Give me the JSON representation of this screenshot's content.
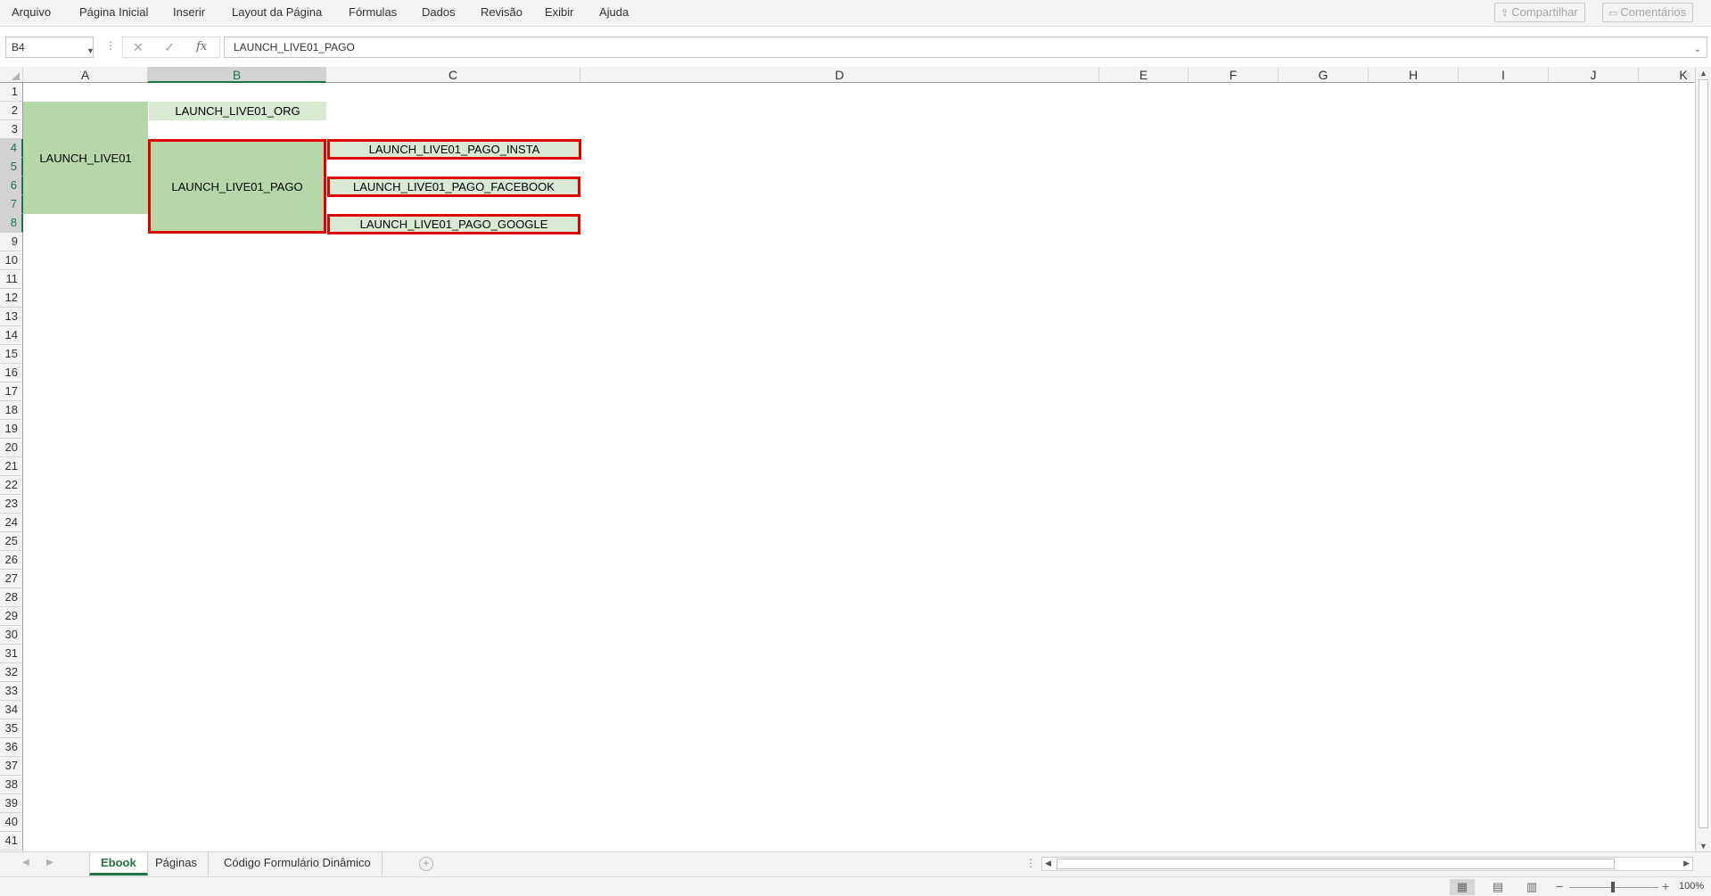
{
  "menu": {
    "items": [
      "Arquivo",
      "Página Inicial",
      "Inserir",
      "Layout da Página",
      "Fórmulas",
      "Dados",
      "Revisão",
      "Exibir",
      "Ajuda"
    ],
    "share_label": "Compartilhar",
    "comments_label": "Comentários"
  },
  "formula_bar": {
    "name_box": "B4",
    "formula": "LAUNCH_LIVE01_PAGO",
    "fx_label": "fx"
  },
  "columns": [
    "A",
    "B",
    "C",
    "D",
    "E",
    "F",
    "G",
    "H",
    "I",
    "J",
    "K"
  ],
  "selected_column": "B",
  "rows": [
    "1",
    "2",
    "3",
    "4",
    "5",
    "6",
    "7",
    "8",
    "9",
    "10",
    "11",
    "12",
    "13",
    "14",
    "15",
    "16",
    "17",
    "18",
    "19",
    "20",
    "21",
    "22",
    "23",
    "24",
    "25",
    "26",
    "27",
    "28",
    "29",
    "30",
    "31",
    "32",
    "33",
    "34",
    "35",
    "36",
    "37",
    "38",
    "39",
    "40",
    "41"
  ],
  "selected_rows": [
    "4",
    "5",
    "6",
    "7",
    "8"
  ],
  "cells": {
    "a2": "LAUNCH_LIVE01",
    "b2": "LAUNCH_LIVE01_ORG",
    "b4": "LAUNCH_LIVE01_PAGO",
    "c4": "LAUNCH_LIVE01_PAGO_INSTA",
    "c6": "LAUNCH_LIVE01_PAGO_FACEBOOK",
    "c8": "LAUNCH_LIVE01_PAGO_GOOGLE"
  },
  "colors": {
    "fill_dark_green": "#b6d7a8",
    "fill_light_green": "#d9ead3",
    "highlight_border": "#e00000",
    "accent": "#217346"
  },
  "sheets": {
    "tabs": [
      "Ebook",
      "Páginas",
      "Código Formulário Dinâmico"
    ],
    "active": "Ebook"
  },
  "status": {
    "zoom": "100%"
  }
}
